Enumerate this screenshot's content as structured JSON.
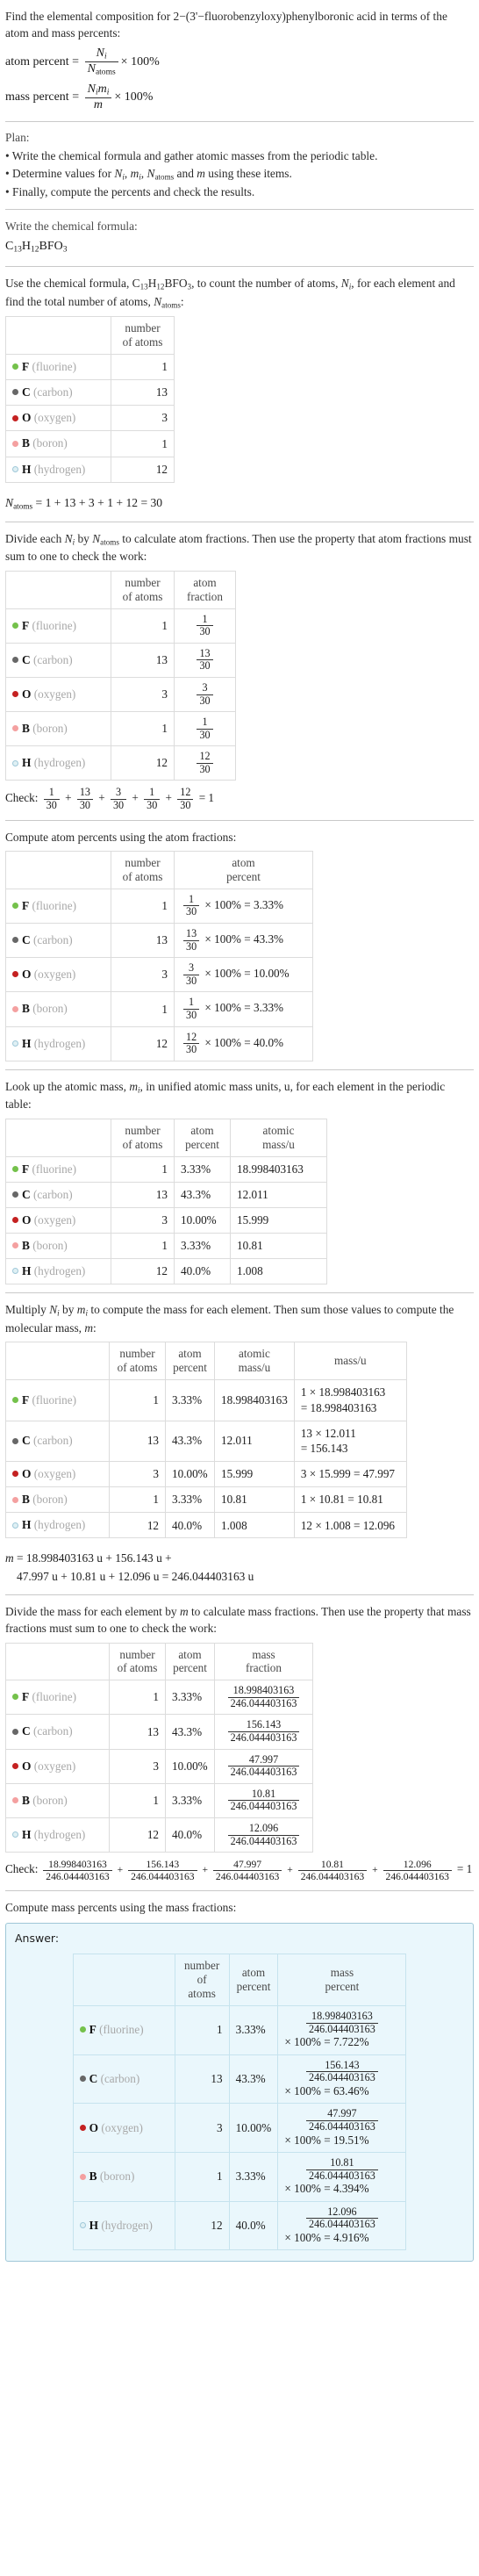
{
  "problem": {
    "statement": "Find the elemental composition for 2−(3'−fluorobenzyloxy)phenylboronic acid in terms of the atom and mass percents:",
    "atom_percent_label": "atom percent = ",
    "mass_percent_label": "mass percent = ",
    "times_100": "× 100%"
  },
  "plan": {
    "heading": "Plan:",
    "items": [
      "• Write the chemical formula and gather atomic masses from the periodic table.",
      "• Finally, compute the percents and check the results."
    ],
    "determine_prefix": "• Determine values for ",
    "determine_suffix": " using these items."
  },
  "formula_section": {
    "prompt": "Write the chemical formula:",
    "formula_plain": "C13H12BFO3"
  },
  "count_section": {
    "prompt_a": "Use the chemical formula, ",
    "prompt_b": ", to count the number of atoms, ",
    "prompt_c": ", for each element and find the total number of atoms, ",
    "prompt_d": ":",
    "header_atoms": "number\nof atoms",
    "natoms_equation": "= 1 + 13 + 3 + 1 + 12 = 30"
  },
  "fraction_section": {
    "prompt_a": "Divide each ",
    "prompt_b": " by ",
    "prompt_c": " to calculate atom fractions. Then use the property that atom fractions must sum to one to check the work:",
    "header_fraction": "atom\nfraction",
    "check_label": "Check:",
    "check_result": "= 1"
  },
  "atom_percent_section": {
    "prompt": "Compute atom percents using the atom fractions:",
    "header_percent": "atom\npercent"
  },
  "atomic_mass_section": {
    "prompt_a": "Look up the atomic mass, ",
    "prompt_b": ", in unified atomic mass units, u, for each element in the periodic table:",
    "header_atomic_mass": "atomic\nmass/u"
  },
  "mass_section": {
    "prompt_a": "Multiply ",
    "prompt_b": " by ",
    "prompt_c": " to compute the mass for each element. Then sum those values to compute the molecular mass, ",
    "prompt_d": ":",
    "header_mass": "mass/u",
    "m_line1": "= 18.998403163 u + 156.143 u +",
    "m_line2": "47.997 u + 10.81 u + 12.096 u = 246.044403163 u"
  },
  "mass_fraction_section": {
    "prompt_a": "Divide the mass for each element by ",
    "prompt_b": " to calculate mass fractions. Then use the property that mass fractions must sum to one to check the work:",
    "header_mass_fraction": "mass\nfraction",
    "check_label": "Check:",
    "check_result": "= 1"
  },
  "mass_percent_section": {
    "prompt": "Compute mass percents using the mass fractions:",
    "answer_label": "Answer:",
    "header_mass_percent": "mass\npercent"
  },
  "totals": {
    "n_atoms_total": "30",
    "molecular_mass": "246.044403163"
  },
  "elements": [
    {
      "symbol": "F",
      "name": "(fluorine)",
      "color": "#74c14b",
      "filled": true,
      "n_atoms": "1",
      "fraction_num": "1",
      "fraction_den": "30",
      "atom_percent": "3.33%",
      "atomic_mass": "18.998403163",
      "mass_expr_line1": "1 × 18.998403163",
      "mass_expr_line2": "= 18.998403163",
      "mass_expr_single": "",
      "mass_value": "18.998403163",
      "mass_percent": "7.722%"
    },
    {
      "symbol": "C",
      "name": "(carbon)",
      "color": "#676767",
      "filled": true,
      "n_atoms": "13",
      "fraction_num": "13",
      "fraction_den": "30",
      "atom_percent": "43.3%",
      "atomic_mass": "12.011",
      "mass_expr_line1": "13 × 12.011",
      "mass_expr_line2": "= 156.143",
      "mass_expr_single": "",
      "mass_value": "156.143",
      "mass_percent": "63.46%"
    },
    {
      "symbol": "O",
      "name": "(oxygen)",
      "color": "#c42121",
      "filled": true,
      "n_atoms": "3",
      "fraction_num": "3",
      "fraction_den": "30",
      "atom_percent": "10.00%",
      "atomic_mass": "15.999",
      "mass_expr_line1": "",
      "mass_expr_line2": "",
      "mass_expr_single": "3 × 15.999 = 47.997",
      "mass_value": "47.997",
      "mass_percent": "19.51%"
    },
    {
      "symbol": "B",
      "name": "(boron)",
      "color": "#f4a0a0",
      "filled": true,
      "n_atoms": "1",
      "fraction_num": "1",
      "fraction_den": "30",
      "atom_percent": "3.33%",
      "atomic_mass": "10.81",
      "mass_expr_line1": "",
      "mass_expr_line2": "",
      "mass_expr_single": "1 × 10.81 = 10.81",
      "mass_value": "10.81",
      "mass_percent": "4.394%"
    },
    {
      "symbol": "H",
      "name": "(hydrogen)",
      "color": "#dff0f4",
      "filled": false,
      "n_atoms": "12",
      "fraction_num": "12",
      "fraction_den": "30",
      "atom_percent": "40.0%",
      "atomic_mass": "1.008",
      "mass_expr_line1": "",
      "mass_expr_line2": "",
      "mass_expr_single": "12 × 1.008 = 12.096",
      "mass_value": "12.096",
      "mass_percent": "4.916%"
    }
  ],
  "symbols": {
    "Ni": "N_i",
    "Natoms": "N_atoms",
    "mi": "m_i",
    "m": "m",
    "times100": "× 100%",
    "plus": "+",
    "equals": "="
  }
}
